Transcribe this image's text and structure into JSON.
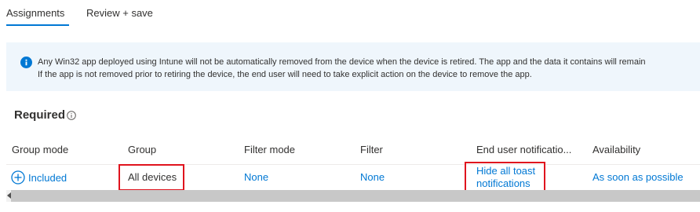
{
  "tabs": [
    {
      "label": "Assignments",
      "active": true
    },
    {
      "label": "Review + save",
      "active": false
    }
  ],
  "banner": {
    "icon": "info-icon",
    "line1": "Any Win32 app deployed using Intune will not be automatically removed from the device when the device is retired. The app and the data it contains will remain",
    "line2": "If the app is not removed prior to retiring the device, the end user will need to take explicit action on the device to remove the app."
  },
  "section": {
    "title": "Required",
    "icon": "info-circle-icon"
  },
  "table": {
    "headers": [
      "Group mode",
      "Group",
      "Filter mode",
      "Filter",
      "End user notificatio...",
      "Availability"
    ],
    "rows": [
      {
        "group_mode": "Included",
        "group_mode_icon": "plus-circle-icon",
        "group": "All devices",
        "filter_mode": "None",
        "filter": "None",
        "notifications_line1": "Hide all toast",
        "notifications_line2": "notifications",
        "availability": "As soon as possible"
      }
    ]
  },
  "colors": {
    "accent": "#0078d4",
    "banner_bg": "#eff6fc",
    "highlight": "#e0141e"
  }
}
